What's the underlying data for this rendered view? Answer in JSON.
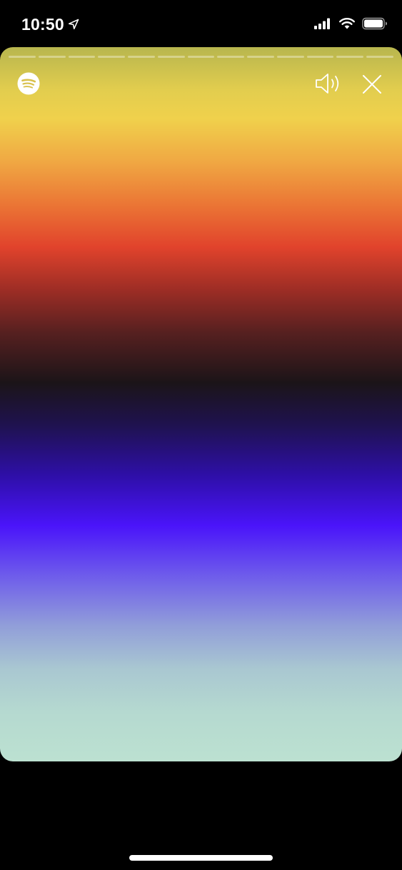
{
  "status_bar": {
    "time": "10:50",
    "icons": [
      "location-arrow-icon",
      "cellular-signal-icon",
      "wifi-icon",
      "battery-icon"
    ]
  },
  "story": {
    "segment_count": 13,
    "logo_icon": "spotify-icon",
    "volume_icon": "speaker-volume-icon",
    "close_icon": "close-icon",
    "gradient_colors": [
      "#b8b64e",
      "#f0d14c",
      "#eb7635",
      "#e1432c",
      "#1b1418",
      "#1f1250",
      "#4a14fa",
      "#919ed9",
      "#bce1d1"
    ]
  },
  "colors": {
    "background": "#000000",
    "foreground": "#ffffff"
  }
}
